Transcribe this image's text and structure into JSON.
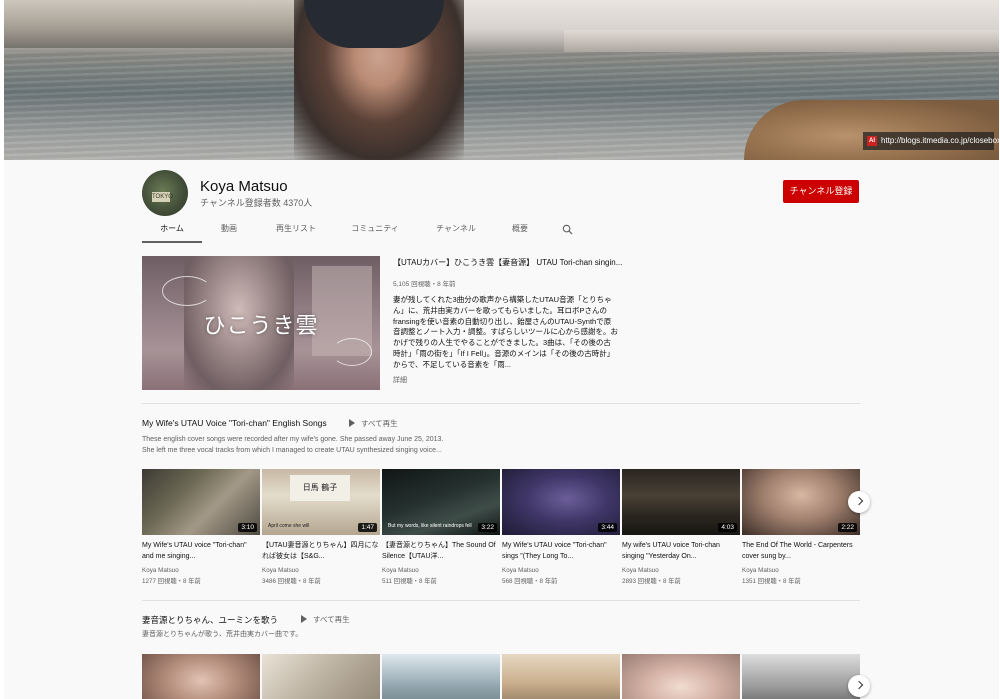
{
  "banner": {
    "link_text": "http://blogs.itmedia.co.jp/closebox/",
    "link_icon_text": "AI"
  },
  "channel": {
    "name": "Koya Matsuo",
    "subscribers": "チャンネル登録者数 4370人",
    "subscribe_label": "チャンネル登録",
    "avatar_sign": "TOKYO"
  },
  "tabs": [
    {
      "label": "ホーム",
      "active": true
    },
    {
      "label": "動画"
    },
    {
      "label": "再生リスト"
    },
    {
      "label": "コミュニティ"
    },
    {
      "label": "チャンネル"
    },
    {
      "label": "概要"
    }
  ],
  "featured": {
    "thumb_text": "ひこうき雲",
    "title": "【UTAUカバー】ひこうき雲【妻音源】 UTAU Tori-chan singin...",
    "meta": "5,105 回視聴・8 年前",
    "description": "妻が残してくれた3曲分の歌声から構築したUTAU音源「とりちゃん」に、荒井由実カバーを歌ってもらいました。耳ロボPさんのfransingを使い音素の自動切り出し、飴屋さんのUTAU-Synthで原音調整とノート入力・調整。すばらしいツールに心から感謝を。おかげで残りの人生でやることができました。3曲は、「その後の古時計」「雨の街を」「If I Fell」。音源のメインは「その後の古時計」からで、不足している音素を「雨...",
    "more": "詳細"
  },
  "shelves": [
    {
      "title": "My Wife's UTAU Voice \"Tori-chan\" English Songs",
      "playall": "すべて再生",
      "description_lines": [
        "These english cover songs were recorded after my wife's gone. She passed away June 25, 2013.",
        "She left me three vocal tracks from which I managed to create UTAU synthesized singing voice..."
      ],
      "videos": [
        {
          "title": "My Wife's UTAU voice \"Tori-chan\" and me singing...",
          "channel": "Koya Matsuo",
          "meta": "1277 回視聴・8 年前",
          "duration": "3:10",
          "thumb_caption": "",
          "thumb_sign": ""
        },
        {
          "title": "【UTAU妻音源とりちゃん】四月になれば彼女は【S&G...",
          "channel": "Koya Matsuo",
          "meta": "3486 回視聴・8 年前",
          "duration": "1:47",
          "thumb_caption": "April come she will",
          "thumb_sign": "日馬 鶴子"
        },
        {
          "title": "【妻音源とりちゃん】The Sound Of Silence【UTAU洋...",
          "channel": "Koya Matsuo",
          "meta": "511 回視聴・8 年前",
          "duration": "3:22",
          "thumb_caption": "But my words, like silent raindrops fell",
          "thumb_sign": ""
        },
        {
          "title": "My Wife's UTAU voice \"Tori-chan\" sings \"(They Long To...",
          "channel": "Koya Matsuo",
          "meta": "568 回視聴・8 年前",
          "duration": "3:44",
          "thumb_caption": "",
          "thumb_sign": ""
        },
        {
          "title": "My wife's UTAU voice Tori-chan singing \"Yesterday On...",
          "channel": "Koya Matsuo",
          "meta": "2893 回視聴・8 年前",
          "duration": "4:03",
          "thumb_caption": "",
          "thumb_sign": ""
        },
        {
          "title": "The End Of The World - Carpenters cover sung by...",
          "channel": "Koya Matsuo",
          "meta": "1351 回視聴・8 年前",
          "duration": "2:22",
          "thumb_caption": "",
          "thumb_sign": ""
        }
      ]
    },
    {
      "title": "妻音源とりちゃん、ユーミンを歌う",
      "playall": "すべて再生",
      "description_lines": [
        "妻音源とりちゃんが歌う、荒井由実カバー曲です。"
      ],
      "videos": [
        {
          "title": "",
          "channel": "",
          "meta": "",
          "duration": ""
        },
        {
          "title": "",
          "channel": "",
          "meta": "",
          "duration": ""
        },
        {
          "title": "",
          "channel": "",
          "meta": "",
          "duration": ""
        },
        {
          "title": "",
          "channel": "",
          "meta": "",
          "duration": ""
        },
        {
          "title": "",
          "channel": "",
          "meta": "",
          "duration": ""
        },
        {
          "title": "",
          "channel": "",
          "meta": "",
          "duration": ""
        }
      ]
    }
  ],
  "colors": {
    "subscribe_bg": "#cc0000",
    "page_bg": "#f9f9f9",
    "secondary_text": "#606060"
  }
}
